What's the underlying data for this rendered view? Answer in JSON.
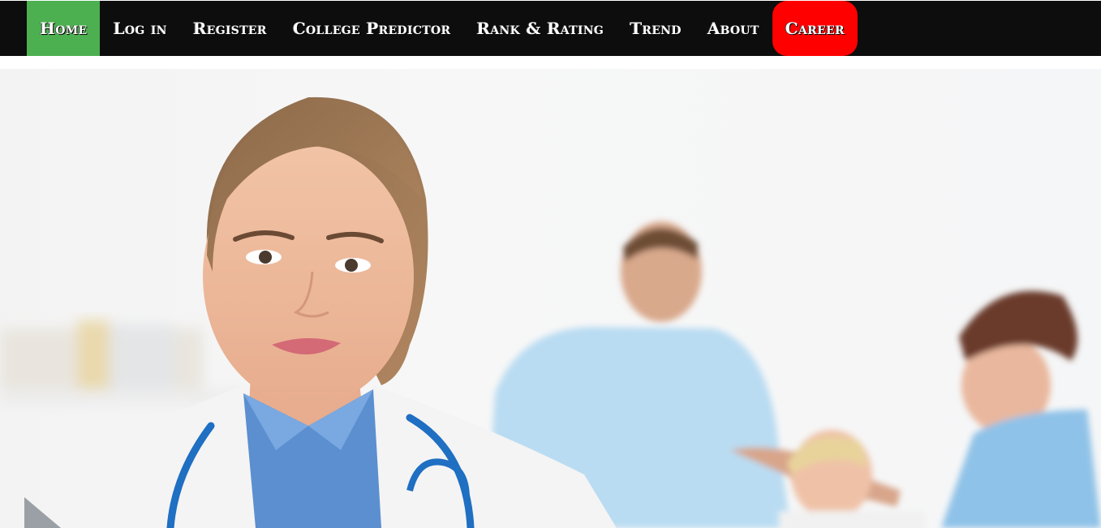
{
  "nav": {
    "items": [
      {
        "label": "Home",
        "active": true
      },
      {
        "label": "Log in"
      },
      {
        "label": "Register"
      },
      {
        "label": "College Predictor"
      },
      {
        "label": "Rank & Rating"
      },
      {
        "label": "Trend"
      },
      {
        "label": "About"
      },
      {
        "label": "Career",
        "highlight": true
      }
    ]
  },
  "colors": {
    "navbar": "#0d0d0d",
    "active": "#4caf50",
    "career": "#ff0000"
  },
  "hero": {
    "image": "doctor-hero-image"
  }
}
